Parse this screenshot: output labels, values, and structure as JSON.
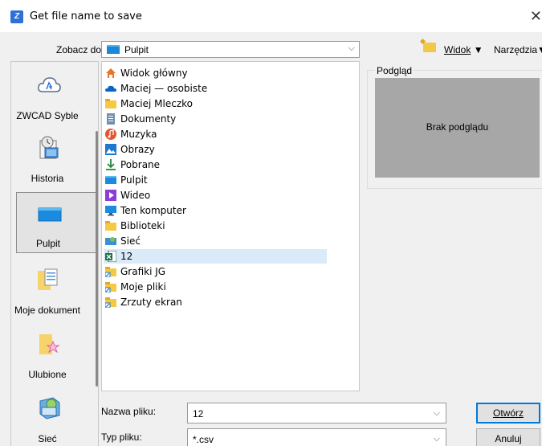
{
  "window": {
    "title": "Get file name to save",
    "close_glyph": "✕"
  },
  "toolbar": {
    "lookin_label": "Zobacz do:",
    "lookin_value": "Pulpit",
    "view_menu": "Widok",
    "tools_menu": "Narzędzia"
  },
  "places": [
    {
      "label": "ZWCAD Syble",
      "icon": "cloud-icon"
    },
    {
      "label": "Historia",
      "icon": "history-icon"
    },
    {
      "label": "Pulpit",
      "icon": "desktop-icon"
    },
    {
      "label": "Moje dokument",
      "icon": "documents-icon"
    },
    {
      "label": "Ulubione",
      "icon": "favorites-icon"
    },
    {
      "label": "Sieć",
      "icon": "network-icon"
    }
  ],
  "files": [
    {
      "name": "Widok główny",
      "icon": "home-icon"
    },
    {
      "name": "Maciej — osobiste",
      "icon": "onedrive-icon"
    },
    {
      "name": "Maciej Mleczko",
      "icon": "user-folder-icon"
    },
    {
      "name": "Dokumenty",
      "icon": "documents-icon"
    },
    {
      "name": "Muzyka",
      "icon": "music-icon"
    },
    {
      "name": "Obrazy",
      "icon": "pictures-icon"
    },
    {
      "name": "Pobrane",
      "icon": "download-icon"
    },
    {
      "name": "Pulpit",
      "icon": "desktop-icon"
    },
    {
      "name": "Wideo",
      "icon": "video-icon"
    },
    {
      "name": "Ten komputer",
      "icon": "computer-icon"
    },
    {
      "name": "Biblioteki",
      "icon": "library-icon"
    },
    {
      "name": "Sieć",
      "icon": "network-icon"
    },
    {
      "name": "12",
      "icon": "excel-file-icon",
      "selected": true
    },
    {
      "name": "Grafiki JG",
      "icon": "shortcut-folder-icon"
    },
    {
      "name": "Moje pliki",
      "icon": "shortcut-folder-icon"
    },
    {
      "name": "Zrzuty ekran",
      "icon": "shortcut-folder-icon"
    }
  ],
  "preview": {
    "label": "Podgląd",
    "empty_text": "Brak podglądu"
  },
  "form": {
    "filename_label": "Nazwa pliku:",
    "filename_value": "12",
    "filetype_label": "Typ pliku:",
    "filetype_value": "*.csv"
  },
  "buttons": {
    "open": "Otwórz",
    "cancel": "Anuluj"
  },
  "colors": {
    "accent": "#0078d7",
    "selection": "#dbeaf8",
    "preview_bg": "#a7a7a7"
  }
}
